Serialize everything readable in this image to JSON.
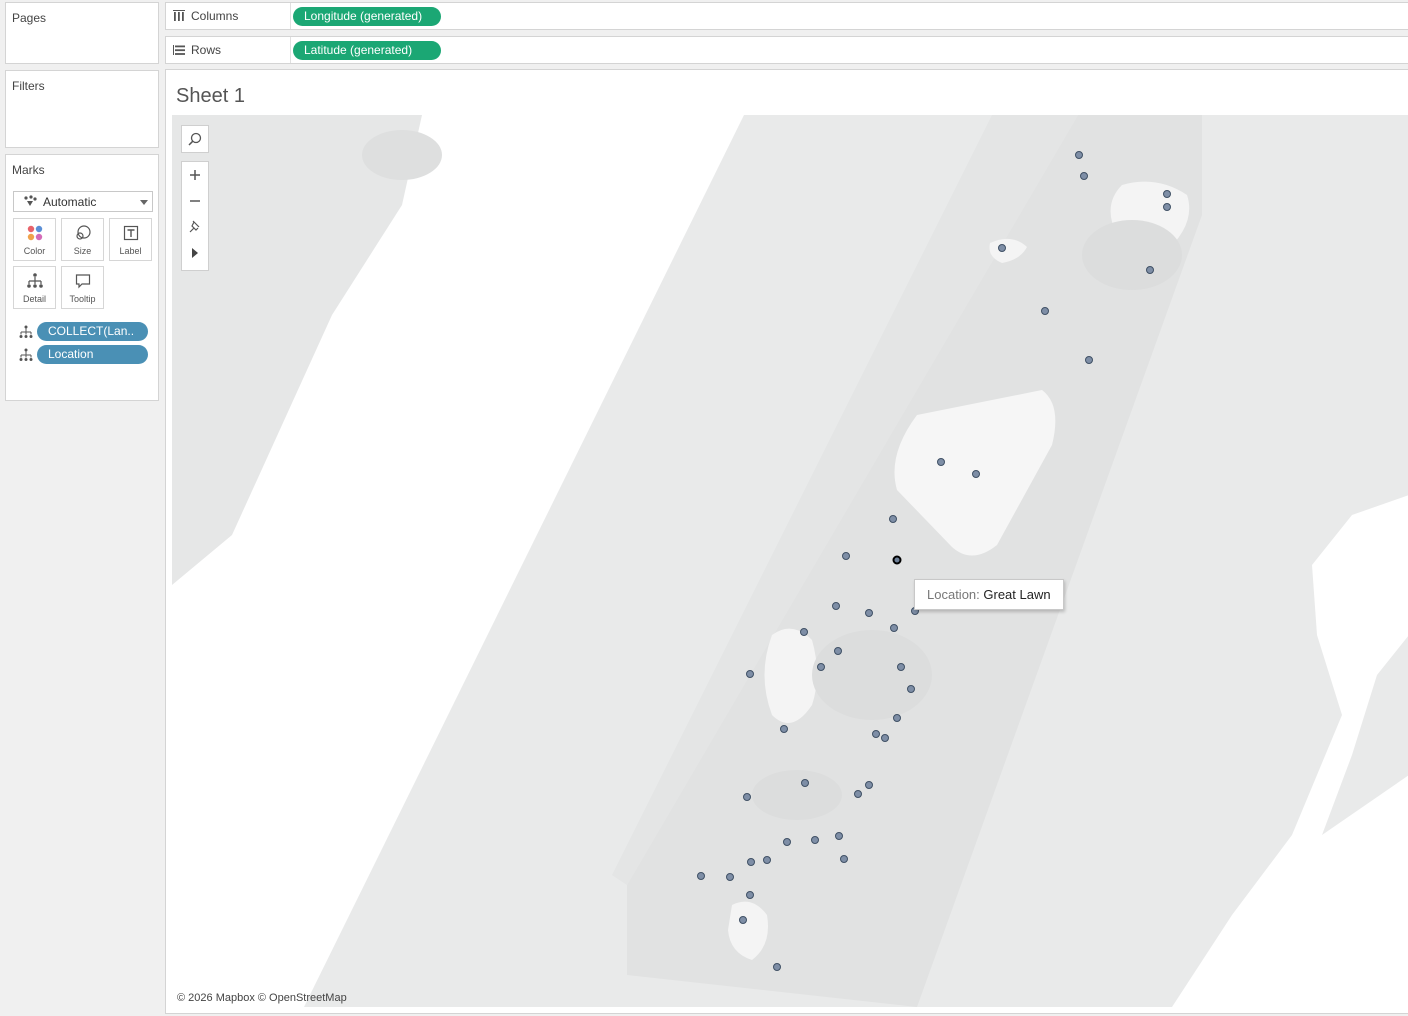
{
  "pages": {
    "title": "Pages"
  },
  "filters": {
    "title": "Filters"
  },
  "marks": {
    "title": "Marks",
    "mark_type": "Automatic",
    "buttons": [
      "Color",
      "Size",
      "Label",
      "Detail",
      "Tooltip"
    ],
    "fields": [
      "COLLECT(Lan..",
      "Location"
    ]
  },
  "shelves": {
    "columns_label": "Columns",
    "columns_pill": "Longitude (generated)",
    "rows_label": "Rows",
    "rows_pill": "Latitude (generated)"
  },
  "sheet": {
    "title": "Sheet 1"
  },
  "tooltip": {
    "key": "Location:",
    "value": "Great Lawn"
  },
  "map": {
    "attribution": "© 2026 Mapbox © OpenStreetMap",
    "point_color": "#7e8ea6",
    "pill_green": "#1ba774",
    "pill_blue": "#4a90b5"
  }
}
